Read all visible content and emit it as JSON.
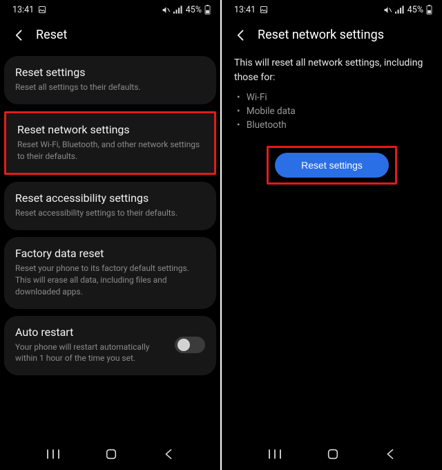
{
  "status": {
    "time": "13:41",
    "battery_pct": "45%"
  },
  "left": {
    "header_title": "Reset",
    "cards": {
      "reset_settings": {
        "title": "Reset settings",
        "sub": "Reset all settings to their defaults."
      },
      "reset_network": {
        "title": "Reset network settings",
        "sub": "Reset Wi-Fi, Bluetooth, and other network settings to their defaults."
      },
      "reset_access": {
        "title": "Reset accessibility settings",
        "sub": "Reset accessibility settings to their defaults."
      },
      "factory": {
        "title": "Factory data reset",
        "sub": "Reset your phone to its factory default settings. This will erase all data, including files and downloaded apps."
      },
      "auto_restart": {
        "title": "Auto restart",
        "sub": "Your phone will restart automatically within 1 hour of the time you set."
      }
    }
  },
  "right": {
    "header_title": "Reset network settings",
    "desc": "This will reset all network settings, including those for:",
    "bullets": {
      "b0": "Wi-Fi",
      "b1": "Mobile data",
      "b2": "Bluetooth"
    },
    "button_label": "Reset settings"
  }
}
